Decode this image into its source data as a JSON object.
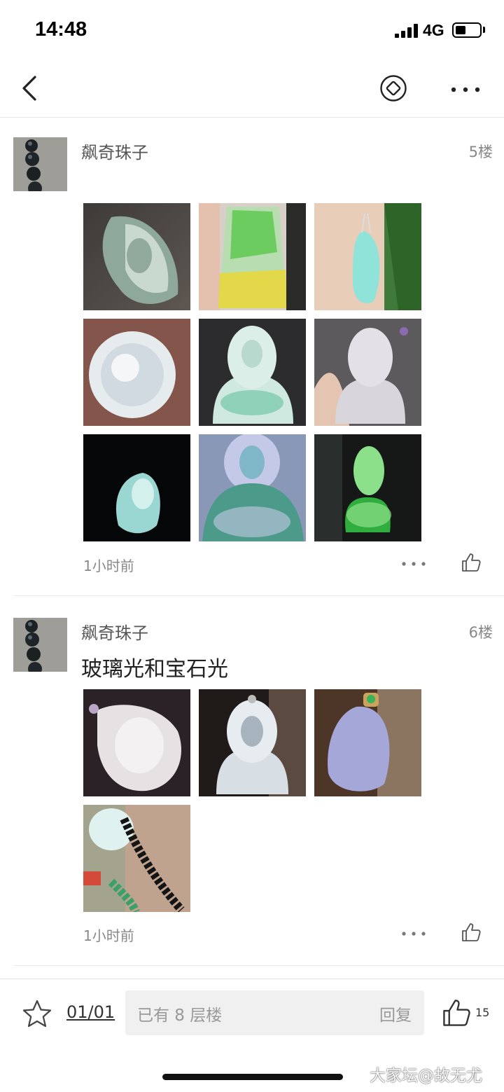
{
  "status_bar": {
    "time": "14:48",
    "network": "4G"
  },
  "nav": {
    "back_icon": "chevron-left-icon",
    "diamond_icon": "diamond-circle-icon",
    "more_icon": "more-icon"
  },
  "posts": [
    {
      "author": "飙奇珠子",
      "floor": "5楼",
      "body": "",
      "time": "1小时前",
      "images": [
        {
          "desc": "jade-leaf-pendant",
          "c1": "#3e3a38",
          "c2": "#8ea89a",
          "c3": "#d9e5dc"
        },
        {
          "desc": "green-yellow-jade-plaque",
          "c1": "#b8ddb0",
          "c2": "#6ccc60",
          "c3": "#e2d84a"
        },
        {
          "desc": "ice-blue-jade-pendant",
          "c1": "#3f7a3a",
          "c2": "#8fe3d8",
          "c3": "#e8cdb8"
        },
        {
          "desc": "white-jade-round-pendant",
          "c1": "#7a4d42",
          "c2": "#e6ebee",
          "c3": "#c8d3da"
        },
        {
          "desc": "clear-jade-buddha",
          "c1": "#2c2b2e",
          "c2": "#cfe8e0",
          "c3": "#7fcbb0"
        },
        {
          "desc": "clear-jade-guanyin",
          "c1": "#5d5a5e",
          "c2": "#d8d6dc",
          "c3": "#e4c5b2"
        },
        {
          "desc": "ice-jade-dragon-pendant",
          "c1": "#050607",
          "c2": "#9bd7d2",
          "c3": "#d4f0ec"
        },
        {
          "desc": "blue-green-jade-guanyin",
          "c1": "#8a98b8",
          "c2": "#4b9a8a",
          "c3": "#c3c9e6"
        },
        {
          "desc": "green-jade-guanyin",
          "c1": "#151817",
          "c2": "#2fae3d",
          "c3": "#8de08a"
        }
      ]
    },
    {
      "author": "飙奇珠子",
      "floor": "6楼",
      "body": "玻璃光和宝石光",
      "time": "1小时前",
      "images": [
        {
          "desc": "white-jade-pixiu",
          "c1": "#2a2226",
          "c2": "#e6e2e3",
          "c3": "#b8a6c4"
        },
        {
          "desc": "white-jade-buddha",
          "c1": "#201b19",
          "c2": "#d8dfe4",
          "c3": "#a7b4bd"
        },
        {
          "desc": "lavender-jade-drop",
          "c1": "#4d3528",
          "c2": "#a4a7d8",
          "c3": "#c9b599"
        },
        {
          "desc": "bracelet-and-pendant",
          "c1": "#bfa38e",
          "c2": "#141414",
          "c3": "#3aa06a"
        }
      ]
    }
  ],
  "bottom_bar": {
    "page_index": "01/01",
    "reply_placeholder": "已有 8 层楼",
    "reply_button": "回复",
    "like_count": "15",
    "watermark": "大家坛@故无尤"
  }
}
